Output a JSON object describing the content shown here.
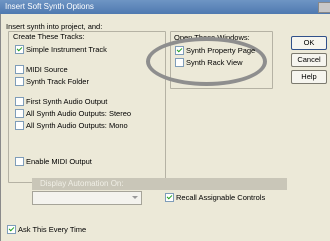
{
  "window": {
    "title": "Insert Soft Synth Options"
  },
  "intro": "Insert synth into project, and:",
  "create_group": {
    "label": "Create These Tracks:",
    "items": [
      {
        "label": "Simple Instrument Track",
        "checked": true
      },
      {
        "label": "MIDI Source",
        "checked": false
      },
      {
        "label": "Synth Track Folder",
        "checked": false
      },
      {
        "label": "First Synth Audio Output",
        "checked": false
      },
      {
        "label": "All Synth Audio Outputs: Stereo",
        "checked": false
      },
      {
        "label": "All Synth Audio Outputs: Mono",
        "checked": false
      }
    ],
    "enable_midi": {
      "label": "Enable MIDI Output",
      "checked": false
    }
  },
  "open_group": {
    "label": "Open These Windows:",
    "items": [
      {
        "label": "Synth Property Page",
        "checked": true
      },
      {
        "label": "Synth Rack View",
        "checked": false
      }
    ]
  },
  "buttons": {
    "ok": "OK",
    "cancel": "Cancel",
    "help": "Help"
  },
  "automation": {
    "header": "Display Automation On:",
    "combo_value": "",
    "recall": {
      "label": "Recall Assignable Controls",
      "checked": true
    }
  },
  "ask": {
    "label": "Ask This Every Time",
    "checked": true
  },
  "colors": {
    "titlebar": "#5a84b8",
    "highlight_ring": "#8e8e8e",
    "check": "#21a121"
  }
}
